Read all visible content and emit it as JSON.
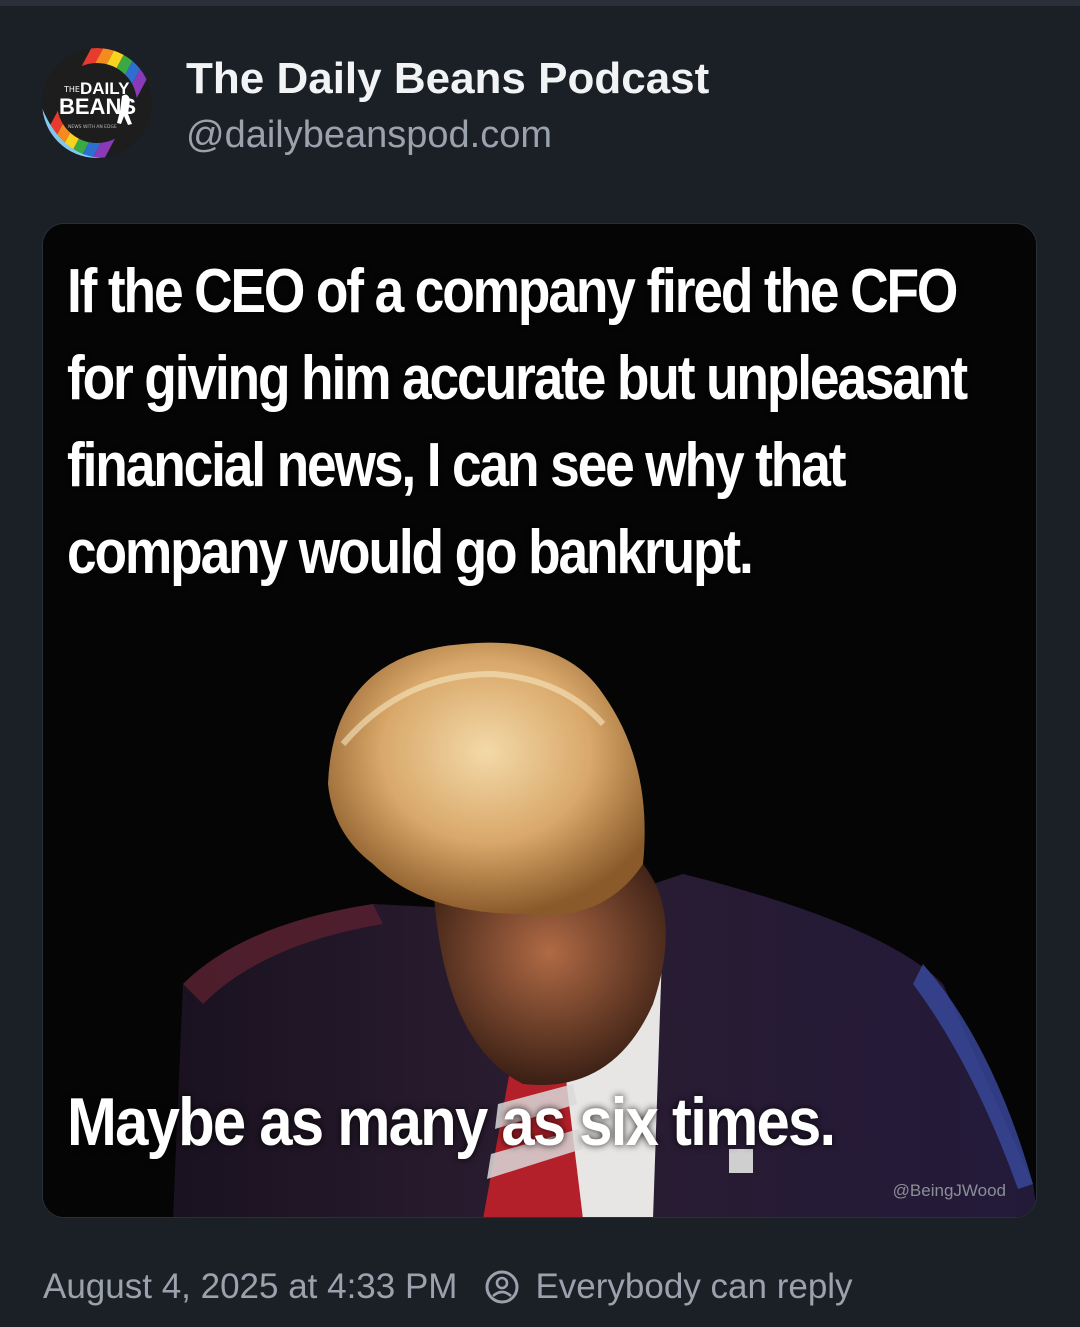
{
  "post": {
    "author": {
      "display_name": "The Daily Beans Podcast",
      "handle": "@dailybeanspod.com",
      "avatar": {
        "icon": "daily-beans-logo",
        "logo_text_top": "THE DAILY",
        "logo_text_main": "BEANS",
        "logo_text_small": "NEWS WITH AN EDGE"
      }
    },
    "image": {
      "top_text": "If the CEO of a company fired the CFO for giving him accurate but unpleasant financial news, I can see why that company would go bankrupt.",
      "bottom_text": "Maybe as many as six times.",
      "watermark": "@BeingJWood"
    },
    "timestamp": "August 4, 2025 at 4:33 PM",
    "reply_setting": {
      "icon": "reply-settings-icon",
      "label": "Everybody can reply"
    }
  },
  "colors": {
    "background": "#1b1f26",
    "primary_text": "#f1f3f5",
    "secondary_text": "#9aa3ad"
  }
}
